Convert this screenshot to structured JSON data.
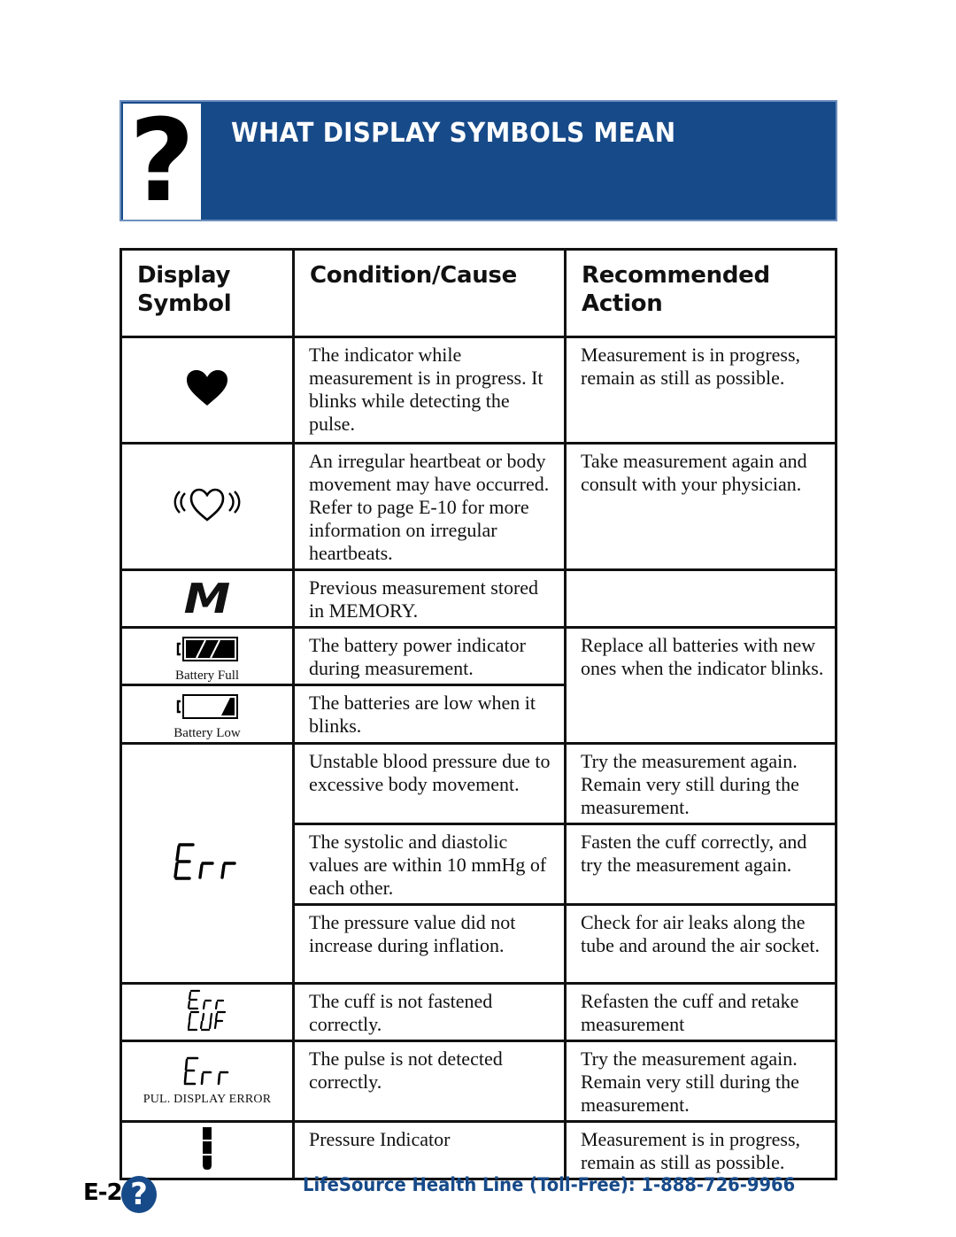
{
  "banner": {
    "icon": "question-mark-icon",
    "icon_glyph": "?",
    "title": "WHAT DISPLAY SYMBOLS MEAN",
    "background_color": "#174a89"
  },
  "table": {
    "headers": {
      "symbol": "Display Symbol",
      "symbol_line1": "Display",
      "symbol_line2": "Symbol",
      "condition": "Condition/Cause",
      "action": "Recommended Action",
      "action_line1": "Recommended",
      "action_line2": "Action"
    },
    "rows": [
      {
        "symbol": "heart-icon",
        "condition": "The indicator while measurement is in progress. It blinks while detecting the pulse.",
        "action": "Measurement is in progress, remain as still as possible."
      },
      {
        "symbol": "irregular-heartbeat-icon",
        "condition": "An irregular heartbeat or body movement may have occurred. Refer to page E-10 for more information on irregular heartbeats.",
        "action": "Take measurement again and consult with your physician."
      },
      {
        "symbol": "memory-icon",
        "symbol_text": "M",
        "condition": "Previous measurement stored in MEMORY.",
        "action": ""
      },
      {
        "symbol": "battery-full-icon",
        "symbol_label": "Battery Full",
        "condition": "The battery power indicator during measurement.",
        "action": "Replace all batteries with new ones when the indicator blinks."
      },
      {
        "symbol": "battery-low-icon",
        "symbol_label": "Battery Low",
        "condition": "The batteries are low when it blinks."
      },
      {
        "symbol": "err-display-icon",
        "symbol_text": "Err",
        "condition": "Unstable blood pressure due to excessive body movement.",
        "action": "Try the measurement again. Remain very still during the measurement."
      },
      {
        "condition": "The systolic and diastolic values are within 10 mmHg of each other.",
        "action": "Fasten the cuff correctly, and try the measurement again."
      },
      {
        "condition": "The pressure value did not increase during inflation.",
        "action": "Check for air leaks along the tube and around the air socket."
      },
      {
        "symbol": "err-cuf-display-icon",
        "symbol_text": "Err CUF",
        "condition": "The cuff is not fastened correctly.",
        "action": "Refasten the cuff and retake measurement"
      },
      {
        "symbol": "pulse-err-display-icon",
        "symbol_text": "Err",
        "symbol_label": "PUL. DISPLAY ERROR",
        "condition": "The pulse is not detected correctly.",
        "action": "Try the measurement again. Remain very still during the measurement."
      },
      {
        "symbol": "pressure-indicator-icon",
        "condition": "Pressure Indicator",
        "action": "Measurement is in progress, remain as still as possible."
      }
    ]
  },
  "footer": {
    "page_number": "E-2",
    "page_icon": "question-mark-icon",
    "page_icon_glyph": "?",
    "health_line": "LifeSource Health Line (Toll-Free): 1-888-726-9966",
    "accent_color": "#174a89"
  }
}
